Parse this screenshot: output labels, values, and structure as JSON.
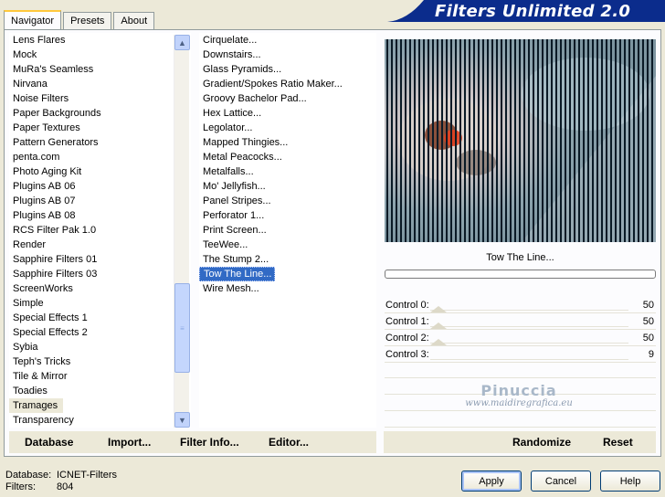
{
  "tabs": [
    "Navigator",
    "Presets",
    "About"
  ],
  "brand": "Filters Unlimited 2.0",
  "categories": [
    "Lens Flares",
    "Mock",
    "MuRa's Seamless",
    "Nirvana",
    "Noise Filters",
    "Paper Backgrounds",
    "Paper Textures",
    "Pattern Generators",
    "penta.com",
    "Photo Aging Kit",
    "Plugins AB 06",
    "Plugins AB 07",
    "Plugins AB 08",
    "RCS Filter Pak 1.0",
    "Render",
    "Sapphire Filters 01",
    "Sapphire Filters 03",
    "ScreenWorks",
    "Simple",
    "Special Effects 1",
    "Special Effects 2",
    "Sybia",
    "Teph's Tricks",
    "Tile & Mirror",
    "Toadies",
    "Tramages",
    "Transparency"
  ],
  "selected_category": "Tramages",
  "filters": [
    "Cirquelate...",
    "Downstairs...",
    "Glass Pyramids...",
    "Gradient/Spokes Ratio Maker...",
    "Groovy Bachelor Pad...",
    "Hex Lattice...",
    "Legolator...",
    "Mapped Thingies...",
    "Metal Peacocks...",
    "Metalfalls...",
    "Mo' Jellyfish...",
    "Panel Stripes...",
    "Perforator 1...",
    "Print Screen...",
    "TeeWee...",
    "The Stump 2...",
    "Tow The Line...",
    "Wire Mesh..."
  ],
  "selected_filter": "Tow The Line...",
  "preview_filter_name": "Tow The Line...",
  "controls": [
    {
      "label": "Control 0:",
      "value": "50"
    },
    {
      "label": "Control 1:",
      "value": "50"
    },
    {
      "label": "Control 2:",
      "value": "50"
    },
    {
      "label": "Control 3:",
      "value": "9"
    }
  ],
  "watermark": {
    "name": "Pinuccia",
    "url": "www.maidiregrafica.eu"
  },
  "left_toolbar": {
    "database": "Database",
    "import": "Import...",
    "filter_info": "Filter Info...",
    "editor": "Editor..."
  },
  "right_toolbar": {
    "randomize": "Randomize",
    "reset": "Reset"
  },
  "info": {
    "database_label": "Database:",
    "database_value": "ICNET-Filters",
    "filters_label": "Filters:",
    "filters_value": "804"
  },
  "buttons": {
    "apply": "Apply",
    "cancel": "Cancel",
    "help": "Help"
  },
  "colors": {
    "selection": "#316ac5",
    "brand_bg": "#0b2c8c",
    "window_bg": "#ece9d8"
  },
  "icons": {
    "scroll_up": "▲",
    "scroll_down": "▼",
    "grip": "≡"
  }
}
